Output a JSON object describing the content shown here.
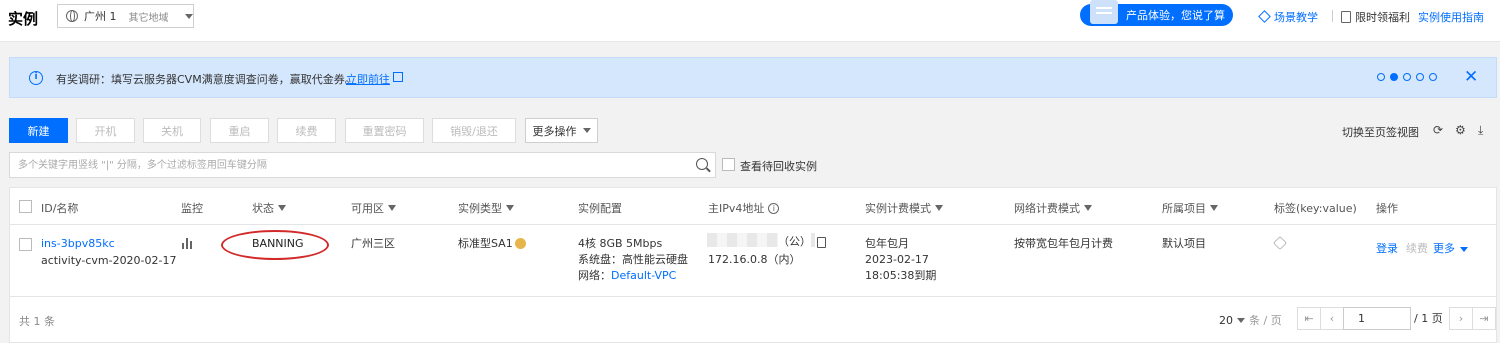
{
  "header": {
    "title": "实例",
    "region": "广州 1",
    "other_regions": "其它地域",
    "experience_label": "产品体验，您说了算",
    "links": {
      "scene": "场景教学",
      "promo": "限时领福利",
      "guide": "实例使用指南"
    }
  },
  "notice": {
    "text": "有奖调研：填写云服务器CVM满意度调查问卷，赢取代金券。",
    "link": "立即前往",
    "close": "✕"
  },
  "toolbar": {
    "buttons": [
      "新建",
      "开机",
      "关机",
      "重启",
      "续费",
      "重置密码",
      "销毁/退还"
    ],
    "more": "更多操作",
    "switch_view": "切换至页签视图"
  },
  "search": {
    "placeholder": "多个关键字用竖线 \"|\" 分隔，多个过滤标签用回车键分隔",
    "recycle_label": "查看待回收实例"
  },
  "table": {
    "headers": [
      "ID/名称",
      "监控",
      "状态",
      "可用区",
      "实例类型",
      "实例配置",
      "主IPv4地址",
      "实例计费模式",
      "网络计费模式",
      "所属项目",
      "标签(key:value)",
      "操作"
    ],
    "row": {
      "id": "ins-3bpv85kc",
      "name": "activity-cvm-2020-02-17",
      "status": "BANNING",
      "zone": "广州三区",
      "type": "标准型SA1",
      "config_line1": "4核 8GB 5Mbps",
      "config_line2": "系统盘：高性能云硬盘",
      "config_network_label": "网络：",
      "config_network_value": "Default-VPC",
      "public_suffix": "（公）",
      "private_ip": "172.16.0.8（内）",
      "billing_mode": "包年包月",
      "billing_date": "2023-02-17",
      "billing_expire": "18:05:38到期",
      "network_billing": "按带宽包年包月计费",
      "project": "默认项目",
      "ops": {
        "login": "登录",
        "renew": "续费",
        "more": "更多"
      }
    },
    "total": "共 1 条",
    "page_size": "20",
    "page_size_unit": "条 / 页",
    "page_current": "1",
    "page_total": "/ 1 页"
  }
}
